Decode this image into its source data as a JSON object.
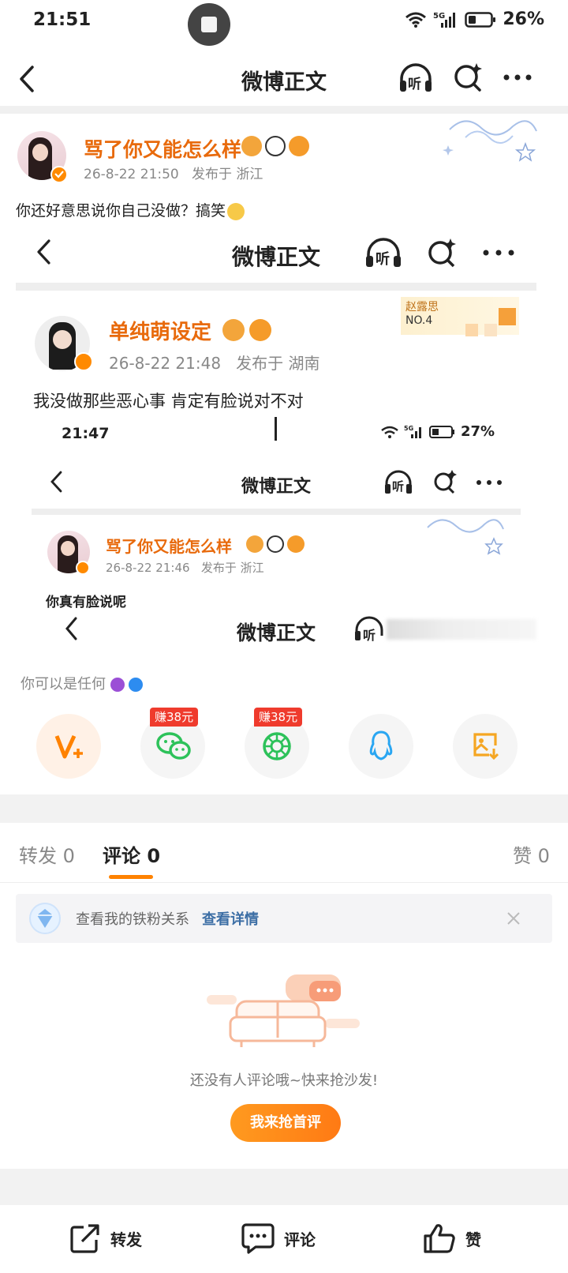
{
  "status_bar": {
    "time": "21:51",
    "battery": "26%"
  },
  "nav": {
    "title": "微博正文",
    "listen": "听"
  },
  "post": {
    "author": "骂了你又能怎么样",
    "date": "26-8-22 21:50",
    "location": "发布于 浙江",
    "text": "你还好意思说你自己没做？搞笑"
  },
  "embedded1": {
    "nav_title": "微博正文",
    "listen": "听",
    "author": "单纯萌设定",
    "date": "26-8-22 21:48",
    "location": "发布于 湖南",
    "text": "我没做那些恶心事 肯定有脸说对不对",
    "badge_name": "赵露思",
    "badge_no": "NO.4"
  },
  "embedded2": {
    "time": "21:47",
    "battery": "27%",
    "nav_title": "微博正文",
    "listen": "听",
    "author": "骂了你又能怎么样",
    "date": "26-8-22 21:46",
    "location": "发布于 浙江",
    "text": "你真有脸说呢"
  },
  "embedded3": {
    "nav_title": "微博正文",
    "listen": "听",
    "caption": "你可以是任何"
  },
  "share": {
    "wechat_badge": "赚38元",
    "moments_badge": "赚38元",
    "icons": [
      "vplus-icon",
      "wechat-icon",
      "moments-icon",
      "qq-icon",
      "save-image-icon"
    ]
  },
  "tabs": {
    "repost": "转发 0",
    "comment": "评论 0",
    "like": "赞 0"
  },
  "fan_card": {
    "text": "查看我的铁粉关系",
    "link": "查看详情"
  },
  "empty": {
    "text": "还没有人评论哦~快来抢沙发!",
    "button": "我来抢首评"
  },
  "bottom": {
    "repost": "转发",
    "comment": "评论",
    "like": "赞"
  },
  "colors": {
    "accent": "#ff8200",
    "name": "#e86a0c",
    "link": "#3c6ea5"
  }
}
